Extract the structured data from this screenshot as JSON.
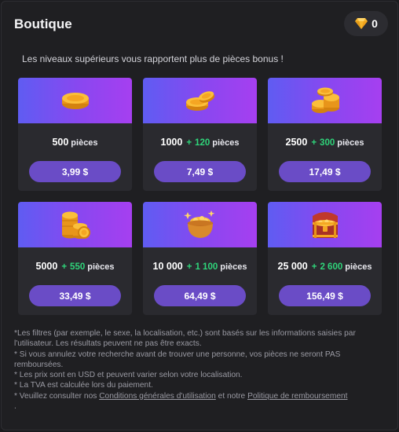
{
  "header": {
    "title": "Boutique",
    "balance": "0",
    "balance_icon": "diamond-icon"
  },
  "subtitle": "Les niveaux supérieurs vous rapportent plus de pièces bonus !",
  "colors": {
    "background": "#1f1f22",
    "card": "#2a2a2f",
    "gradient_start": "#5f5cf2",
    "gradient_end": "#a63ff0",
    "price_button": "#6a4cc6",
    "bonus_green": "#2fd47a",
    "gold": "#f5a623"
  },
  "packages": [
    {
      "icon": "single-coin-stack-icon",
      "base": "500",
      "bonus": "",
      "unit": "pièces",
      "price": "3,99 $"
    },
    {
      "icon": "two-coins-icon",
      "base": "1000",
      "bonus": "120",
      "unit": "pièces",
      "price": "7,49 $"
    },
    {
      "icon": "coin-stacks-icon",
      "base": "2500",
      "bonus": "300",
      "unit": "pièces",
      "price": "17,49 $"
    },
    {
      "icon": "tall-coin-stacks-icon",
      "base": "5000",
      "bonus": "550",
      "unit": "pièces",
      "price": "33,49 $"
    },
    {
      "icon": "coin-pot-icon",
      "base": "10 000",
      "bonus": "1 100",
      "unit": "pièces",
      "price": "64,49 $"
    },
    {
      "icon": "treasure-chest-icon",
      "base": "25 000",
      "bonus": "2 600",
      "unit": "pièces",
      "price": "156,49 $"
    }
  ],
  "bonus_prefix": "+",
  "notes": {
    "line1": "*Les filtres (par exemple, le sexe, la localisation, etc.) sont basés sur les informations saisies par l'utilisateur. Les résultats peuvent ne pas être exacts.",
    "line2": "* Si vous annulez votre recherche avant de trouver une personne, vos pièces ne seront PAS remboursées.",
    "line3": "* Les prix sont en USD et peuvent varier selon votre localisation.",
    "line4": "* La TVA est calculée lors du paiement.",
    "line5_prefix": "* Veuillez consulter nos",
    "terms_link": "Conditions générales d'utilisation",
    "line5_middle": "et notre",
    "refund_link": "Politique de remboursement",
    "line5_suffix": "."
  }
}
